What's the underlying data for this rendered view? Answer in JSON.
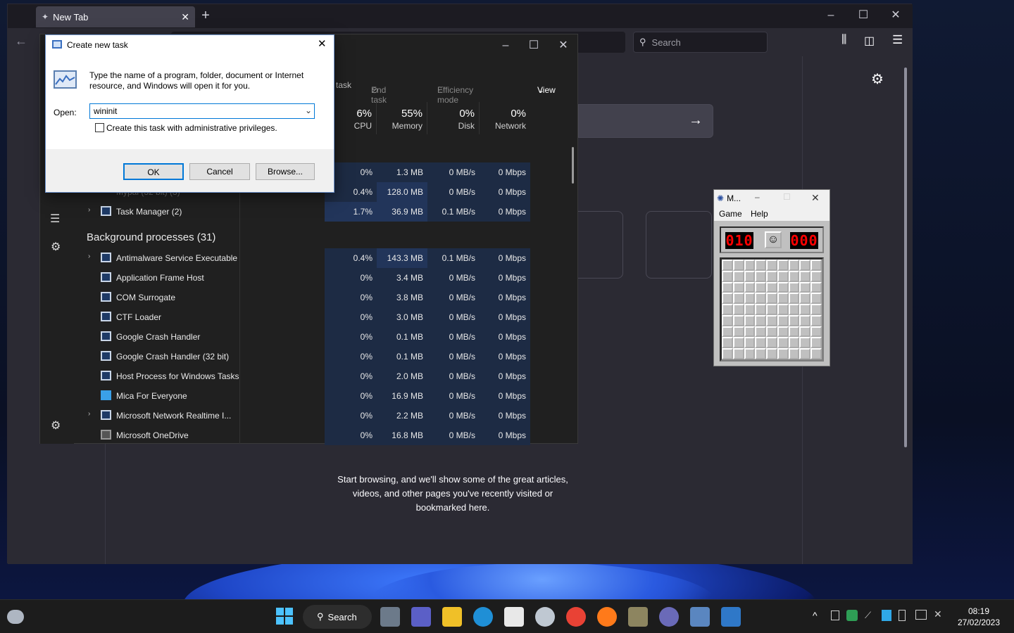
{
  "firefox": {
    "tab_title": "New Tab",
    "search_placeholder": "Search",
    "body_text_line1": "Start browsing, and we'll show some of the great articles,",
    "body_text_line2": "videos, and other pages you've recently visited or",
    "body_text_line3": "bookmarked here."
  },
  "taskmanager": {
    "cmd": {
      "run_task": "task",
      "end_task": "End task",
      "efficiency": "Efficiency mode",
      "view": "View"
    },
    "columns": [
      {
        "pct": "6%",
        "label": "CPU"
      },
      {
        "pct": "55%",
        "label": "Memory"
      },
      {
        "pct": "0%",
        "label": "Disk"
      },
      {
        "pct": "0%",
        "label": "Network"
      }
    ],
    "apps_rows": [
      {
        "name": "",
        "cpu": "0%",
        "mem": "1.3 MB",
        "disk": "0 MB/s",
        "net": "0 Mbps"
      },
      {
        "name": "Mypal (32 bit) (3)",
        "cpu": "0.4%",
        "mem": "128.0 MB",
        "disk": "0 MB/s",
        "net": "0 Mbps"
      },
      {
        "name": "Task Manager (2)",
        "cpu": "1.7%",
        "mem": "36.9 MB",
        "disk": "0.1 MB/s",
        "net": "0 Mbps"
      }
    ],
    "section_title": "Background processes (31)",
    "bg_rows": [
      {
        "name": "Antimalware Service Executable",
        "cpu": "0.4%",
        "mem": "143.3 MB",
        "disk": "0.1 MB/s",
        "net": "0 Mbps"
      },
      {
        "name": "Application Frame Host",
        "cpu": "0%",
        "mem": "3.4 MB",
        "disk": "0 MB/s",
        "net": "0 Mbps"
      },
      {
        "name": "COM Surrogate",
        "cpu": "0%",
        "mem": "3.8 MB",
        "disk": "0 MB/s",
        "net": "0 Mbps"
      },
      {
        "name": "CTF Loader",
        "cpu": "0%",
        "mem": "3.0 MB",
        "disk": "0 MB/s",
        "net": "0 Mbps"
      },
      {
        "name": "Google Crash Handler",
        "cpu": "0%",
        "mem": "0.1 MB",
        "disk": "0 MB/s",
        "net": "0 Mbps"
      },
      {
        "name": "Google Crash Handler (32 bit)",
        "cpu": "0%",
        "mem": "0.1 MB",
        "disk": "0 MB/s",
        "net": "0 Mbps"
      },
      {
        "name": "Host Process for Windows Tasks",
        "cpu": "0%",
        "mem": "2.0 MB",
        "disk": "0 MB/s",
        "net": "0 Mbps"
      },
      {
        "name": "Mica For Everyone",
        "cpu": "0%",
        "mem": "16.9 MB",
        "disk": "0 MB/s",
        "net": "0 Mbps"
      },
      {
        "name": "Microsoft Network Realtime I...",
        "cpu": "0%",
        "mem": "2.2 MB",
        "disk": "0 MB/s",
        "net": "0 Mbps"
      },
      {
        "name": "Microsoft OneDrive",
        "cpu": "0%",
        "mem": "16.8 MB",
        "disk": "0 MB/s",
        "net": "0 Mbps"
      }
    ]
  },
  "run": {
    "title": "Create new task",
    "desc_line1": "Type the name of a program, folder, document or Internet",
    "desc_line2": "resource, and Windows will open it for you.",
    "open_label": "Open:",
    "input_value": "wininit",
    "admin_label": "Create this task with administrative privileges.",
    "ok": "OK",
    "cancel": "Cancel",
    "browse": "Browse..."
  },
  "minesweeper": {
    "title": "M...",
    "menu_game": "Game",
    "menu_help": "Help",
    "mines": "010",
    "timer": "000"
  },
  "taskbar": {
    "search": "Search",
    "time": "08:19",
    "date": "27/02/2023"
  }
}
